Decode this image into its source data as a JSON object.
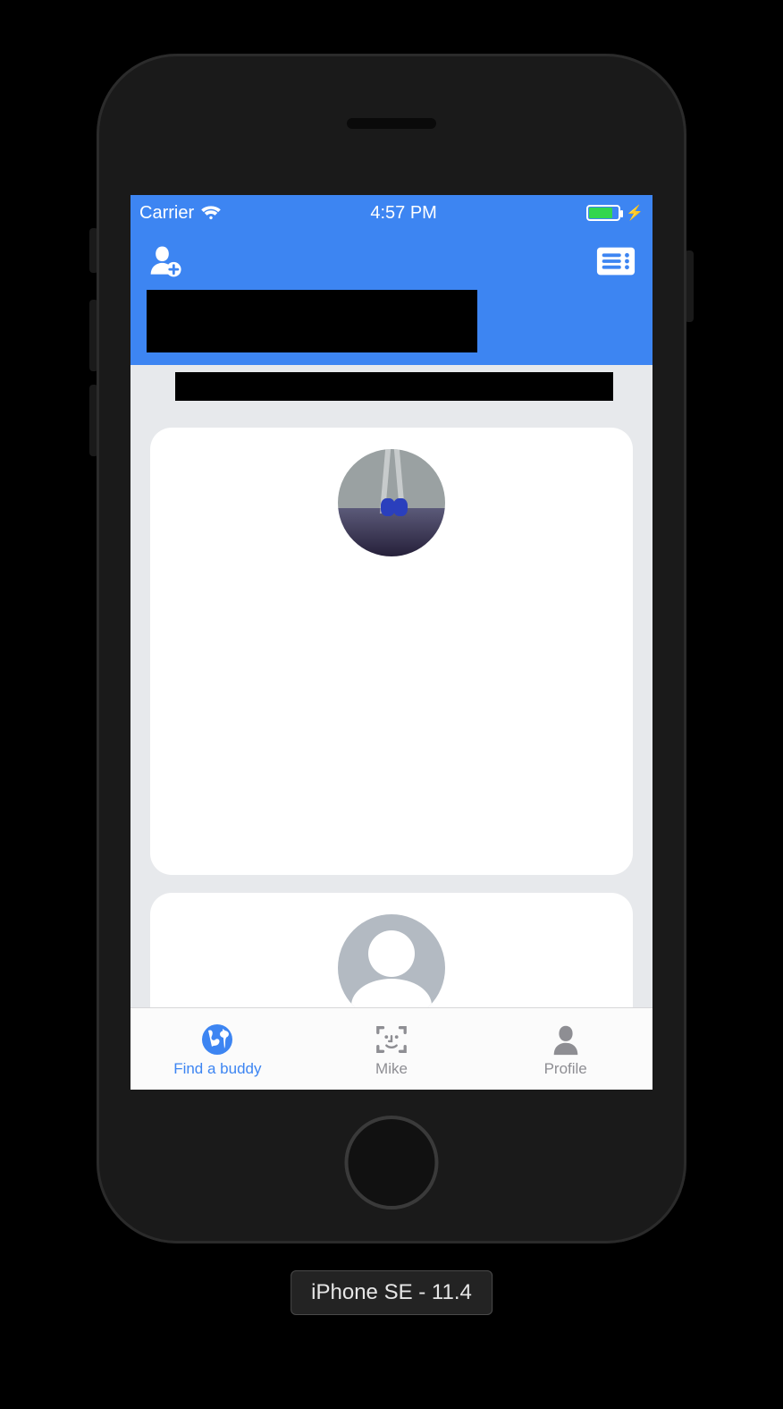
{
  "status": {
    "carrier": "Carrier",
    "time": "4:57 PM"
  },
  "nav": {
    "icons": {
      "left": "add-person-icon",
      "right": "list-icon"
    }
  },
  "tabs": [
    {
      "label": "Find a buddy",
      "icon": "globe-icon",
      "active": true
    },
    {
      "label": "Mike",
      "icon": "face-id-icon",
      "active": false
    },
    {
      "label": "Profile",
      "icon": "person-icon",
      "active": false
    }
  ],
  "device_label": "iPhone SE - 11.4"
}
